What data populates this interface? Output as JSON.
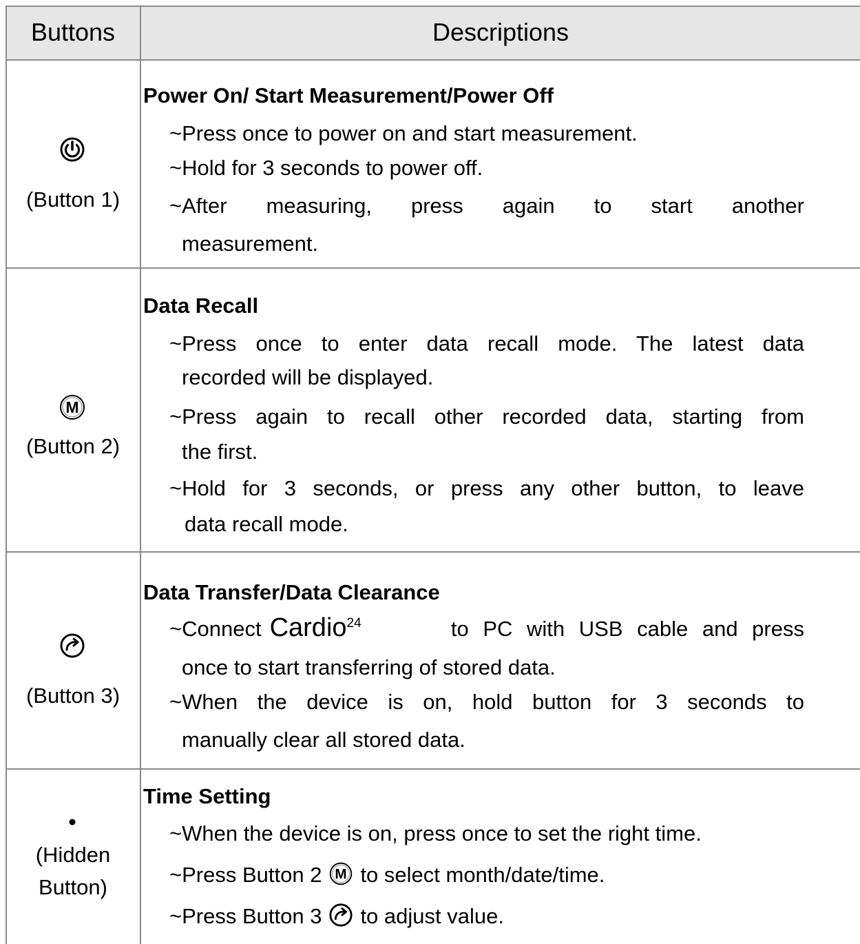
{
  "header": {
    "buttons": "Buttons",
    "descriptions": "Descriptions"
  },
  "rows": [
    {
      "icon": "power-icon",
      "label": "(Button 1)",
      "title": "Power On/ Start Measurement/Power Off",
      "lines": [
        "~Press once to power on and start measurement.",
        "~Hold for 3 seconds to power off.",
        "~After measuring, press again to start another",
        "measurement."
      ]
    },
    {
      "icon": "m-circle-icon",
      "label": "(Button 2)",
      "title": "Data Recall",
      "lines": [
        "~Press once to enter data recall mode. The latest data",
        "recorded will be displayed.",
        "~Press again to recall other recorded data, starting from",
        "the first.",
        "~Hold for 3 seconds, or press any other button, to leave",
        "data recall mode."
      ]
    },
    {
      "icon": "transfer-arrow-icon",
      "label": "(Button 3)",
      "title": "Data Transfer/Data Clearance",
      "lines_parts": {
        "l1_pre": "~Connect",
        "l1_brand": "Cardio",
        "l1_sup": "24",
        "l1_post": "to PC with USB cable and press"
      },
      "lines": [
        "once to start transferring of stored data.",
        "~When the device is on, hold button for 3 seconds to",
        "manually clear all stored data."
      ]
    },
    {
      "icon": "dot-icon",
      "label_1": "(Hidden",
      "label_2": "Button)",
      "title": "Time Setting",
      "lines": [
        "~When the device is on, press once to set the right time.",
        "~Press Button 2",
        "to select month/date/time.",
        "~Press Button 3",
        "to adjust value."
      ]
    }
  ],
  "colors": {
    "header_bg": "#e6e6e6",
    "grid": "#8a8a8a"
  }
}
